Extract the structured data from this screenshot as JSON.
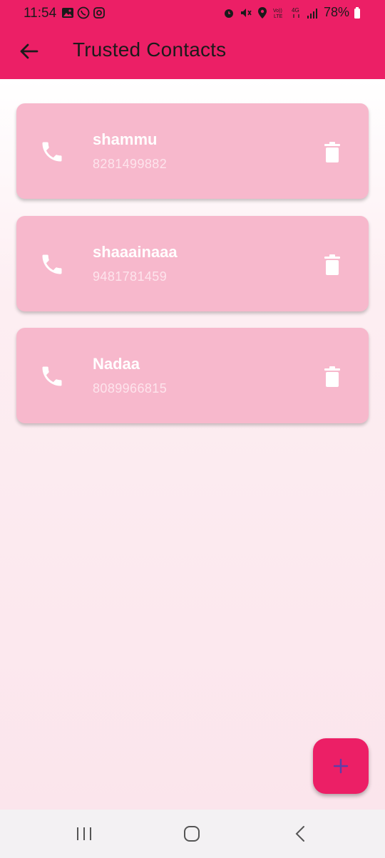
{
  "status_bar": {
    "time": "11:54",
    "battery": "78%",
    "icons": [
      "gallery-icon",
      "whatsapp-icon",
      "instagram-icon",
      "alarm-icon",
      "mute-icon",
      "location-icon",
      "volte-icon",
      "4g-icon",
      "signal-icon",
      "battery-icon"
    ]
  },
  "app_bar": {
    "title": "Trusted Contacts",
    "back_icon": "arrow-back-icon"
  },
  "contacts": [
    {
      "name": "shammu",
      "number": "8281499882"
    },
    {
      "name": "shaaainaaa",
      "number": "9481781459"
    },
    {
      "name": "Nadaa",
      "number": "8089966815"
    }
  ],
  "fab": {
    "icon": "plus-icon"
  },
  "colors": {
    "primary": "#ec1f66",
    "card": "#f7b8cc",
    "fab_icon": "#5b3fa8"
  },
  "nav_bar": {
    "icons": [
      "recents-icon",
      "home-icon",
      "back-icon"
    ]
  }
}
